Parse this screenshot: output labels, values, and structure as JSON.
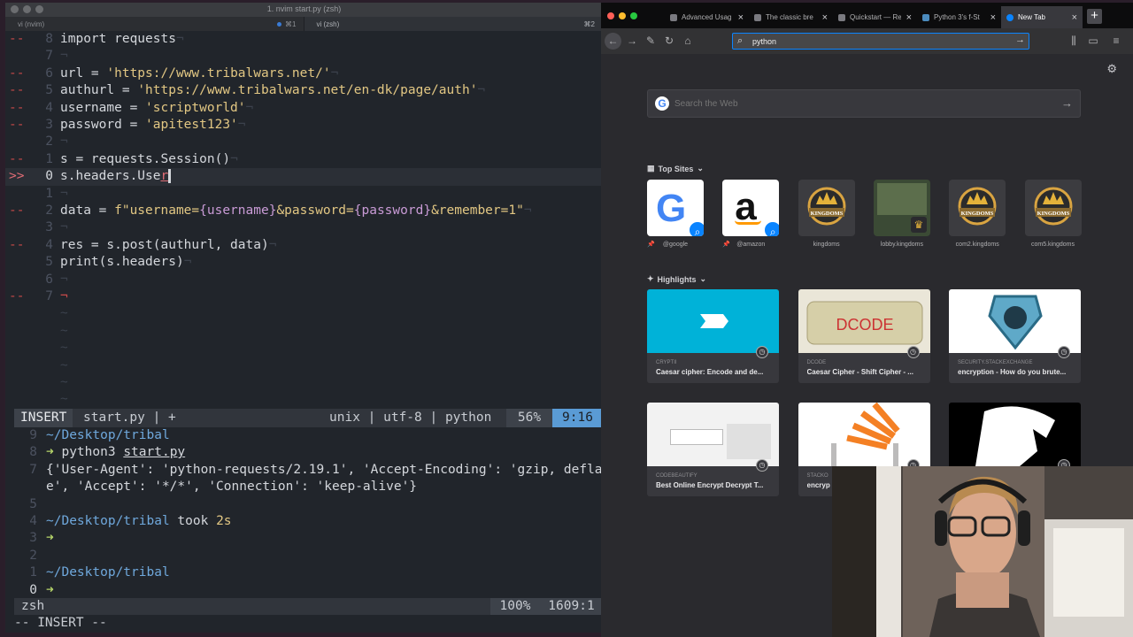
{
  "terminal": {
    "title": "1. nvim start.py (zsh)",
    "tabs": [
      {
        "label": "vi (nvim)",
        "shortcut": "⌘1"
      },
      {
        "label": "vi (zsh)",
        "shortcut": "⌘2"
      }
    ],
    "editor_lines": [
      {
        "sign": "--",
        "num": "8",
        "parts": [
          [
            "kw",
            "import requests"
          ],
          [
            "tilde",
            "¬"
          ]
        ]
      },
      {
        "sign": "",
        "num": "7",
        "parts": [
          [
            "tilde",
            "¬"
          ]
        ]
      },
      {
        "sign": "--",
        "num": "6",
        "parts": [
          [
            "kw",
            "url = "
          ],
          [
            "str",
            "'https://www.tribalwars.net/'"
          ],
          [
            "tilde",
            "¬"
          ]
        ]
      },
      {
        "sign": "--",
        "num": "5",
        "parts": [
          [
            "kw",
            "authurl = "
          ],
          [
            "str",
            "'https://www.tribalwars.net/en-dk/page/auth'"
          ],
          [
            "tilde",
            "¬"
          ]
        ]
      },
      {
        "sign": "--",
        "num": "4",
        "parts": [
          [
            "kw",
            "username = "
          ],
          [
            "str",
            "'scriptworld'"
          ],
          [
            "tilde",
            "¬"
          ]
        ]
      },
      {
        "sign": "--",
        "num": "3",
        "parts": [
          [
            "kw",
            "password = "
          ],
          [
            "str",
            "'apitest123'"
          ],
          [
            "tilde",
            "¬"
          ]
        ]
      },
      {
        "sign": "",
        "num": "2",
        "parts": [
          [
            "tilde",
            "¬"
          ]
        ]
      },
      {
        "sign": "--",
        "num": "1",
        "parts": [
          [
            "kw",
            "s = requests.Session()"
          ],
          [
            "tilde",
            "¬"
          ]
        ]
      },
      {
        "sign": ">>",
        "num": "0",
        "cur": true,
        "parts": [
          [
            "kw",
            "s.headers.Use"
          ],
          [
            "err",
            "r"
          ],
          [
            "cursor",
            " "
          ]
        ]
      },
      {
        "sign": "",
        "num": "1",
        "parts": [
          [
            "tilde",
            "¬"
          ]
        ]
      },
      {
        "sign": "--",
        "num": "2",
        "parts": [
          [
            "kw",
            "data = "
          ],
          [
            "str",
            "f\"username="
          ],
          [
            "fint",
            "{username}"
          ],
          [
            "str",
            "&password="
          ],
          [
            "fint",
            "{password}"
          ],
          [
            "str",
            "&remember=1\""
          ],
          [
            "tilde",
            "¬"
          ]
        ]
      },
      {
        "sign": "",
        "num": "3",
        "parts": [
          [
            "tilde",
            "¬"
          ]
        ]
      },
      {
        "sign": "--",
        "num": "4",
        "parts": [
          [
            "kw",
            "res = s.post(authurl, data)"
          ],
          [
            "tilde",
            "¬"
          ]
        ]
      },
      {
        "sign": "",
        "num": "5",
        "parts": [
          [
            "kw",
            "print(s.headers)"
          ],
          [
            "tilde",
            "¬"
          ]
        ]
      },
      {
        "sign": "",
        "num": "6",
        "parts": [
          [
            "tilde",
            "¬"
          ]
        ]
      },
      {
        "sign": "--",
        "num": "7",
        "parts": [
          [
            "eot",
            "¬"
          ]
        ]
      },
      {
        "sign": "",
        "num": "",
        "parts": [
          [
            "tilde",
            "~"
          ]
        ]
      },
      {
        "sign": "",
        "num": "",
        "parts": [
          [
            "tilde",
            "~"
          ]
        ]
      },
      {
        "sign": "",
        "num": "",
        "parts": [
          [
            "tilde",
            "~"
          ]
        ]
      },
      {
        "sign": "",
        "num": "",
        "parts": [
          [
            "tilde",
            "~"
          ]
        ]
      },
      {
        "sign": "",
        "num": "",
        "parts": [
          [
            "tilde",
            "~"
          ]
        ]
      },
      {
        "sign": "",
        "num": "",
        "parts": [
          [
            "tilde",
            "~"
          ]
        ]
      }
    ],
    "statusline": {
      "mode": "INSERT",
      "file": "start.py | +",
      "encoding": "unix | utf-8 | python",
      "percent": "56%",
      "position": "9:16"
    },
    "shell_lines": [
      {
        "num": "9",
        "parts": [
          [
            "path",
            "~/Desktop/tribal"
          ]
        ]
      },
      {
        "num": "8",
        "parts": [
          [
            "arrow",
            "➜ "
          ],
          [
            "kw",
            "python3 "
          ],
          [
            "under",
            "start.py"
          ]
        ]
      },
      {
        "num": "7",
        "parts": [
          [
            "kw",
            "{'User-Agent': 'python-requests/2.19.1', 'Accept-Encoding': 'gzip, deflat"
          ]
        ]
      },
      {
        "num": "",
        "parts": [
          [
            "kw",
            "e', 'Accept': '*/*', 'Connection': 'keep-alive'}"
          ]
        ]
      },
      {
        "num": "5",
        "parts": []
      },
      {
        "num": "4",
        "parts": [
          [
            "path",
            "~/Desktop/tribal "
          ],
          [
            "took",
            "took "
          ],
          [
            "dur",
            "2s"
          ]
        ]
      },
      {
        "num": "3",
        "parts": [
          [
            "arrow",
            "➜"
          ]
        ]
      },
      {
        "num": "2",
        "parts": []
      },
      {
        "num": "1",
        "parts": [
          [
            "path",
            "~/Desktop/tribal"
          ]
        ]
      },
      {
        "num": "0",
        "cur": true,
        "parts": [
          [
            "arrow",
            "➜"
          ]
        ]
      }
    ],
    "shell_status": {
      "name": "zsh",
      "percent": "100%",
      "position": "1609:1"
    },
    "cmdline": "-- INSERT --"
  },
  "browser": {
    "tabs": [
      {
        "label": "Advanced Usag",
        "active": false
      },
      {
        "label": "The classic bre",
        "active": false
      },
      {
        "label": "Quickstart — Re",
        "active": false
      },
      {
        "label": "Python 3's f-St",
        "active": false
      },
      {
        "label": "New Tab",
        "active": true
      }
    ],
    "newtab_label": "+",
    "url_value": "python",
    "websearch_placeholder": "Search the Web",
    "top_sites_label": "Top Sites",
    "top_sites": [
      {
        "label": "@google",
        "pinned": true
      },
      {
        "label": "@amazon",
        "pinned": true
      },
      {
        "label": "kingdoms",
        "pinned": false
      },
      {
        "label": "lobby.kingdoms",
        "pinned": false
      },
      {
        "label": "com2.kingdoms",
        "pinned": false
      },
      {
        "label": "com5.kingdoms",
        "pinned": false
      }
    ],
    "highlights_label": "Highlights",
    "highlights": [
      {
        "host": "CRYPTII",
        "title": "Caesar cipher: Encode and de..."
      },
      {
        "host": "DCODE",
        "title": "Caesar Cipher - Shift Cipher - ..."
      },
      {
        "host": "SECURITY.STACKEXCHANGE",
        "title": "encryption - How do you brute..."
      },
      {
        "host": "CODEBEAUTIFY",
        "title": "Best Online Encrypt Decrypt T..."
      },
      {
        "host": "STACKO",
        "title": "encryp"
      },
      {
        "host": "",
        "title": ""
      }
    ],
    "crest_text": "KINGDOMS",
    "dcode_text": "DCODE"
  },
  "colors": {
    "accent": "#0a84ff",
    "terminal_bg": "#21252b",
    "browser_bg": "#2a2a2e",
    "string": "#e2c783",
    "path": "#6fa8dc"
  }
}
